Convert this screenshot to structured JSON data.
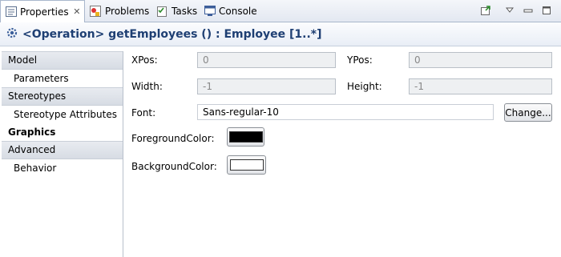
{
  "tabs": [
    {
      "label": "Properties",
      "icon": "properties-icon",
      "active": true
    },
    {
      "label": "Problems",
      "icon": "problems-icon"
    },
    {
      "label": "Tasks",
      "icon": "tasks-icon"
    },
    {
      "label": "Console",
      "icon": "console-icon"
    }
  ],
  "header": {
    "title": "<Operation> getEmployees () : Employee [1..*]"
  },
  "sidebar": {
    "items": [
      {
        "label": "Model",
        "kind": "category"
      },
      {
        "label": "Parameters",
        "kind": "item"
      },
      {
        "label": "Stereotypes",
        "kind": "category"
      },
      {
        "label": "Stereotype Attributes",
        "kind": "item"
      },
      {
        "label": "Graphics",
        "kind": "selected"
      },
      {
        "label": "Advanced",
        "kind": "category"
      },
      {
        "label": "Behavior",
        "kind": "item"
      }
    ]
  },
  "graphics": {
    "xpos_label": "XPos:",
    "xpos_value": "0",
    "ypos_label": "YPos:",
    "ypos_value": "0",
    "width_label": "Width:",
    "width_value": "-1",
    "height_label": "Height:",
    "height_value": "-1",
    "font_label": "Font:",
    "font_value": "Sans-regular-10",
    "change_label": "Change...",
    "fg_label": "ForegroundColor:",
    "fg_color": "#000000",
    "bg_label": "BackgroundColor:",
    "bg_color": "#ffffff"
  }
}
